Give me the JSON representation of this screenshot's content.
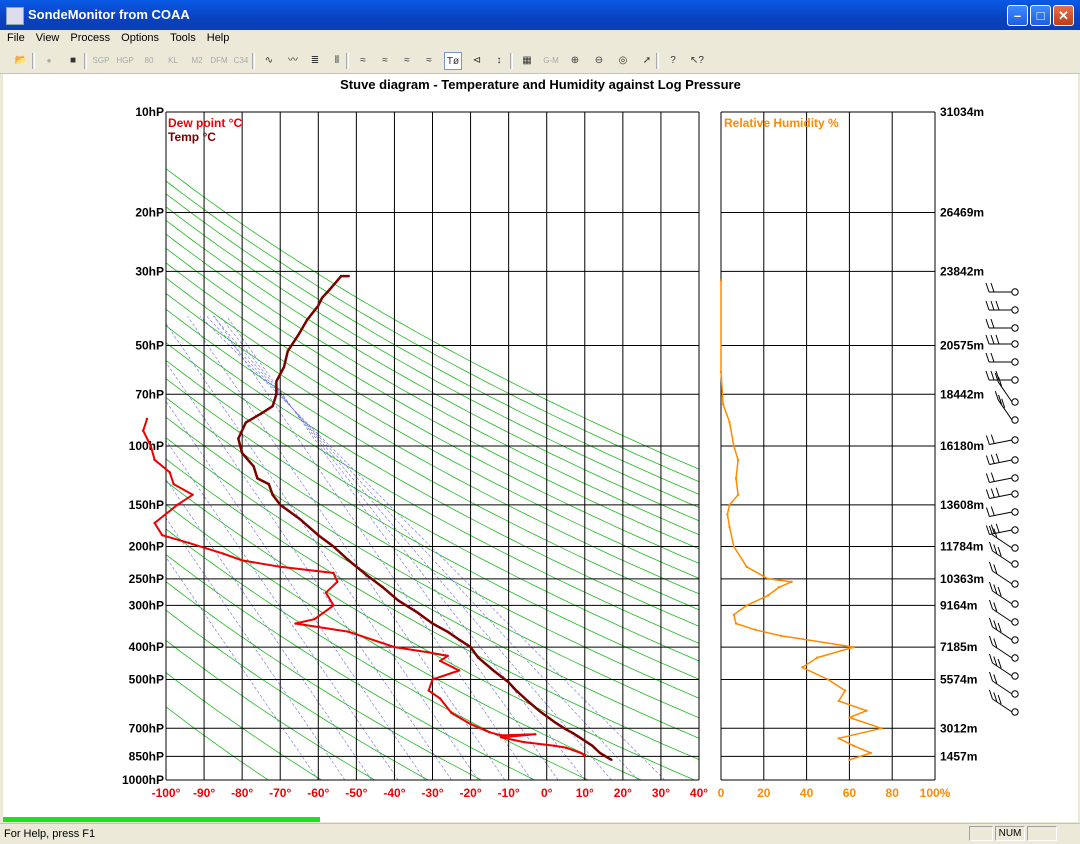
{
  "window": {
    "title": "SondeMonitor from COAA"
  },
  "menu": [
    "File",
    "View",
    "Process",
    "Options",
    "Tools",
    "Help"
  ],
  "toolbar": {
    "buttons": [
      {
        "name": "open-icon",
        "glyph": "📂",
        "enabled": true
      },
      {
        "name": "record-icon",
        "glyph": "●",
        "enabled": false
      },
      {
        "name": "stop-icon",
        "glyph": "■",
        "enabled": true
      },
      {
        "name": "sgp-icon",
        "glyph": "SGP",
        "enabled": false
      },
      {
        "name": "hgp-icon",
        "glyph": "HGP",
        "enabled": false
      },
      {
        "name": "80-icon",
        "glyph": "80",
        "enabled": false
      },
      {
        "name": "kl-icon",
        "glyph": "KL",
        "enabled": false
      },
      {
        "name": "m2k2-icon",
        "glyph": "M2",
        "enabled": false
      },
      {
        "name": "dfm06-icon",
        "glyph": "DFM",
        "enabled": false
      },
      {
        "name": "c34-icon",
        "glyph": "C34",
        "enabled": false
      },
      {
        "name": "sine-wave-icon",
        "glyph": "∿",
        "enabled": true
      },
      {
        "name": "double-wave-icon",
        "glyph": "〰",
        "enabled": true
      },
      {
        "name": "bars-icon",
        "glyph": "≣",
        "enabled": true
      },
      {
        "name": "thin-bars-icon",
        "glyph": "⦀",
        "enabled": true
      },
      {
        "name": "graph-1-icon",
        "glyph": "≈",
        "enabled": true
      },
      {
        "name": "graph-2-icon",
        "glyph": "≈",
        "enabled": true
      },
      {
        "name": "graph-3-icon",
        "glyph": "≈",
        "enabled": true
      },
      {
        "name": "graph-4-icon",
        "glyph": "≈",
        "enabled": true
      },
      {
        "name": "stuve-diagram-icon",
        "glyph": "Tø",
        "enabled": true,
        "selected": true
      },
      {
        "name": "wind-icon",
        "glyph": "⊲",
        "enabled": true
      },
      {
        "name": "altitude-icon",
        "glyph": "↕",
        "enabled": true
      },
      {
        "name": "map-icon",
        "glyph": "▦",
        "enabled": true
      },
      {
        "name": "gm-icon",
        "glyph": "G-M",
        "enabled": false
      },
      {
        "name": "zoom-in-icon",
        "glyph": "⊕",
        "enabled": true
      },
      {
        "name": "zoom-out-icon",
        "glyph": "⊖",
        "enabled": true
      },
      {
        "name": "target-icon",
        "glyph": "◎",
        "enabled": true
      },
      {
        "name": "track-icon",
        "glyph": "➚",
        "enabled": true
      },
      {
        "name": "help-icon",
        "glyph": "?",
        "enabled": true
      },
      {
        "name": "context-help-icon",
        "glyph": "↖?",
        "enabled": true
      }
    ]
  },
  "status": {
    "help": "For Help, press F1",
    "num": "NUM"
  },
  "colors": {
    "temp": "#7a0000",
    "dew": "#ee0000",
    "rh": "#ff8a00",
    "green": "#1fb91f",
    "blue": "#6c6ce0"
  },
  "chart_data": {
    "title": "Stuve diagram - Temperature and Humidity against Log Pressure",
    "type": "line",
    "y_scale": "log",
    "pressure_levels_hPa": [
      10,
      20,
      30,
      50,
      70,
      100,
      150,
      200,
      250,
      300,
      400,
      500,
      700,
      850,
      1000
    ],
    "pressure_labels": [
      "10hP",
      "20hP",
      "30hP",
      "50hP",
      "70hP",
      "100hP",
      "150hP",
      "200hP",
      "250hP",
      "300hP",
      "400hP",
      "500hP",
      "700hP",
      "850hP",
      "1000hP"
    ],
    "altitude_labels": [
      "31034m",
      "26469m",
      "23842m",
      "20575m",
      "18442m",
      "16180m",
      "13608m",
      "11784m",
      "10363m",
      "9164m",
      "7185m",
      "5574m",
      "3012m",
      "1457m",
      ""
    ],
    "temp_axis": {
      "ticks": [
        -100,
        -90,
        -80,
        -70,
        -60,
        -50,
        -40,
        -30,
        -20,
        -10,
        0,
        10,
        20,
        30,
        40
      ],
      "labels": [
        "-100°",
        "-90°",
        "-80°",
        "-70°",
        "-60°",
        "-50°",
        "-40°",
        "-30°",
        "-20°",
        "-10°",
        "0°",
        "10°",
        "20°",
        "30°",
        "40°"
      ]
    },
    "rh_axis": {
      "ticks": [
        0,
        20,
        40,
        60,
        80,
        100
      ],
      "labels": [
        "0",
        "20",
        "40",
        "60",
        "80",
        "100%"
      ]
    },
    "series": [
      {
        "name": "Temp °C",
        "panel": "temperature",
        "points": [
          [
            17,
            870
          ],
          [
            14,
            830
          ],
          [
            12,
            790
          ],
          [
            9,
            750
          ],
          [
            7,
            725
          ],
          [
            5,
            705
          ],
          [
            2,
            670
          ],
          [
            -2,
            620
          ],
          [
            -5,
            580
          ],
          [
            -8,
            540
          ],
          [
            -10,
            510
          ],
          [
            -14,
            470
          ],
          [
            -18,
            430
          ],
          [
            -20,
            400
          ],
          [
            -23,
            380
          ],
          [
            -26,
            360
          ],
          [
            -30,
            340
          ],
          [
            -34,
            315
          ],
          [
            -39,
            290
          ],
          [
            -43,
            265
          ],
          [
            -47,
            245
          ],
          [
            -52,
            220
          ],
          [
            -56,
            200
          ],
          [
            -60,
            185
          ],
          [
            -65,
            165
          ],
          [
            -70,
            150
          ],
          [
            -72,
            140
          ],
          [
            -73,
            130
          ],
          [
            -76,
            125
          ],
          [
            -77,
            115
          ],
          [
            -80,
            105
          ],
          [
            -81,
            95
          ],
          [
            -79,
            85
          ],
          [
            -75,
            80
          ],
          [
            -72,
            76
          ],
          [
            -71,
            70
          ],
          [
            -71,
            64
          ],
          [
            -69,
            58
          ],
          [
            -68,
            52
          ],
          [
            -65,
            46
          ],
          [
            -63,
            42
          ],
          [
            -60,
            38
          ],
          [
            -59,
            36
          ],
          [
            -57,
            34
          ],
          [
            -55,
            32
          ],
          [
            -54,
            31
          ],
          [
            -52,
            31
          ]
        ]
      },
      {
        "name": "Dew point °C",
        "panel": "temperature",
        "points": [
          [
            10,
            845
          ],
          [
            9,
            830
          ],
          [
            5,
            800
          ],
          [
            2,
            790
          ],
          [
            -6,
            770
          ],
          [
            -12,
            745
          ],
          [
            -3,
            730
          ],
          [
            -12,
            735
          ],
          [
            -15,
            720
          ],
          [
            -20,
            680
          ],
          [
            -25,
            630
          ],
          [
            -28,
            570
          ],
          [
            -31,
            540
          ],
          [
            -30,
            500
          ],
          [
            -23,
            470
          ],
          [
            -28,
            440
          ],
          [
            -26,
            425
          ],
          [
            -31,
            415
          ],
          [
            -40,
            400
          ],
          [
            -52,
            360
          ],
          [
            -66,
            340
          ],
          [
            -61,
            330
          ],
          [
            -56,
            300
          ],
          [
            -58,
            275
          ],
          [
            -55,
            255
          ],
          [
            -56,
            240
          ],
          [
            -70,
            230
          ],
          [
            -80,
            220
          ],
          [
            -85,
            210
          ],
          [
            -94,
            195
          ],
          [
            -101,
            185
          ],
          [
            -103,
            170
          ],
          [
            -97,
            150
          ],
          [
            -93,
            140
          ],
          [
            -98,
            130
          ],
          [
            -99,
            120
          ],
          [
            -103,
            110
          ],
          [
            -104,
            100
          ],
          [
            -106,
            90
          ],
          [
            -105,
            83
          ]
        ]
      },
      {
        "name": "Relative Humidity %",
        "panel": "humidity",
        "points": [
          [
            0,
            32
          ],
          [
            0,
            60
          ],
          [
            1,
            75
          ],
          [
            4,
            85
          ],
          [
            6,
            100
          ],
          [
            8,
            110
          ],
          [
            7,
            125
          ],
          [
            8,
            140
          ],
          [
            4,
            150
          ],
          [
            3,
            160
          ],
          [
            4,
            175
          ],
          [
            6,
            200
          ],
          [
            12,
            230
          ],
          [
            22,
            250
          ],
          [
            33,
            255
          ],
          [
            27,
            265
          ],
          [
            22,
            280
          ],
          [
            12,
            300
          ],
          [
            6,
            320
          ],
          [
            7,
            340
          ],
          [
            16,
            355
          ],
          [
            28,
            370
          ],
          [
            62,
            400
          ],
          [
            45,
            430
          ],
          [
            38,
            460
          ],
          [
            50,
            500
          ],
          [
            58,
            540
          ],
          [
            55,
            580
          ],
          [
            68,
            620
          ],
          [
            60,
            650
          ],
          [
            75,
            700
          ],
          [
            55,
            750
          ],
          [
            62,
            790
          ],
          [
            70,
            830
          ],
          [
            60,
            870
          ]
        ]
      }
    ]
  }
}
